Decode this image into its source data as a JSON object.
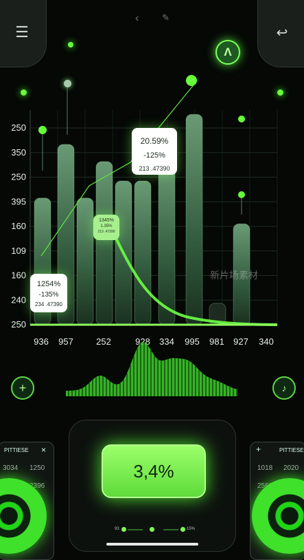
{
  "nav": {
    "menu_icon": "menu-lines-icon",
    "back_icon": "chevron-left-icon",
    "edit_icon": "pencil-icon",
    "undo_icon": "undo-arrow-icon",
    "up_label": "Λ",
    "up_icon": "chevron-up-icon"
  },
  "chart_data": {
    "type": "bar",
    "y_tick_labels": [
      "250",
      "350",
      "250",
      "395",
      "160",
      "109",
      "160",
      "240",
      "250"
    ],
    "categories": [
      "936",
      "957",
      "252",
      "928",
      "334",
      "995",
      "981",
      "927",
      "340"
    ],
    "bars": [
      {
        "label": "936",
        "value": 0.59
      },
      {
        "label": "957",
        "value": 0.84
      },
      {
        "label": "",
        "value": 0.59
      },
      {
        "label": "252",
        "value": 0.76
      },
      {
        "label": "",
        "value": 0.67
      },
      {
        "label": "928",
        "value": 0.67
      },
      {
        "label": "334",
        "value": 0.76
      },
      {
        "label": "995",
        "value": 0.98
      },
      {
        "label": "981",
        "value": 0.1
      },
      {
        "label": "927",
        "value": 0.47
      }
    ],
    "value_note": "bar heights as fraction of plot height",
    "accent_color": "#68ff3c"
  },
  "cards": {
    "left": {
      "l1": "1254%",
      "l2": "-135%",
      "l3": "234 .47390"
    },
    "green": {
      "l1": "1345%",
      "l2": "1.35%",
      "l3": "213 .47390"
    },
    "big": {
      "l1": "20.59%",
      "l2": "-125%",
      "l3": "213 .47390"
    }
  },
  "controls": {
    "plus_label": "+",
    "music_label": "♪",
    "value_display": "3,4%"
  },
  "side_left": {
    "title": "Pittiese",
    "close": "×",
    "n1": "3034",
    "n2": "1250",
    "n3": "2396"
  },
  "side_right": {
    "title": "Pittiese",
    "plus": "+",
    "n1": "1018",
    "n2": "2020",
    "n3": "2560"
  },
  "pager": {
    "left": "93",
    "right": "15%"
  },
  "watermark": "新片场素材"
}
